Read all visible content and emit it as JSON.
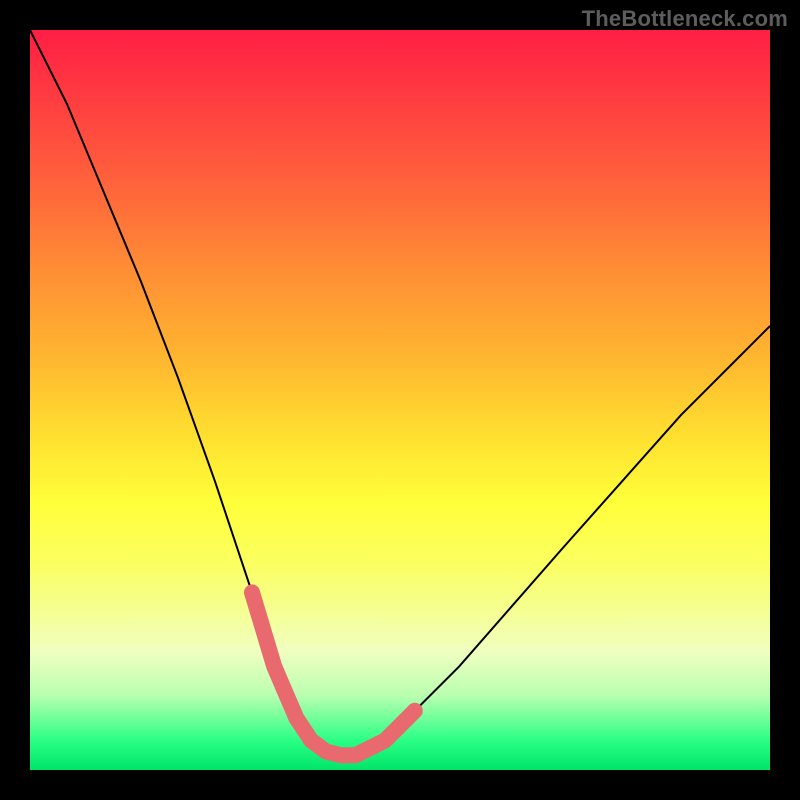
{
  "watermark": "TheBottleneck.com",
  "chart_data": {
    "type": "line",
    "title": "",
    "xlabel": "",
    "ylabel": "",
    "xlim": [
      0,
      100
    ],
    "ylim": [
      0,
      100
    ],
    "series": [
      {
        "name": "curve",
        "x": [
          0,
          5,
          10,
          15,
          20,
          25,
          30,
          33,
          36,
          38,
          40,
          42,
          44,
          48,
          52,
          58,
          65,
          72,
          80,
          88,
          95,
          100
        ],
        "values": [
          100,
          90,
          78,
          66,
          53,
          39,
          24,
          14,
          7,
          4,
          2.5,
          2,
          2,
          4,
          8,
          14,
          22,
          30,
          39,
          48,
          55,
          60
        ]
      }
    ],
    "highlight": {
      "name": "bottleneck-range",
      "x": [
        30,
        33,
        36,
        38,
        40,
        42,
        44,
        48,
        52
      ],
      "values": [
        24,
        14,
        7,
        4,
        2.5,
        2,
        2,
        4,
        8
      ]
    },
    "colors": {
      "curve": "#000000",
      "highlight": "#e86a6f",
      "gradient_top": "#ff1e45",
      "gradient_bottom": "#00e56a"
    }
  }
}
